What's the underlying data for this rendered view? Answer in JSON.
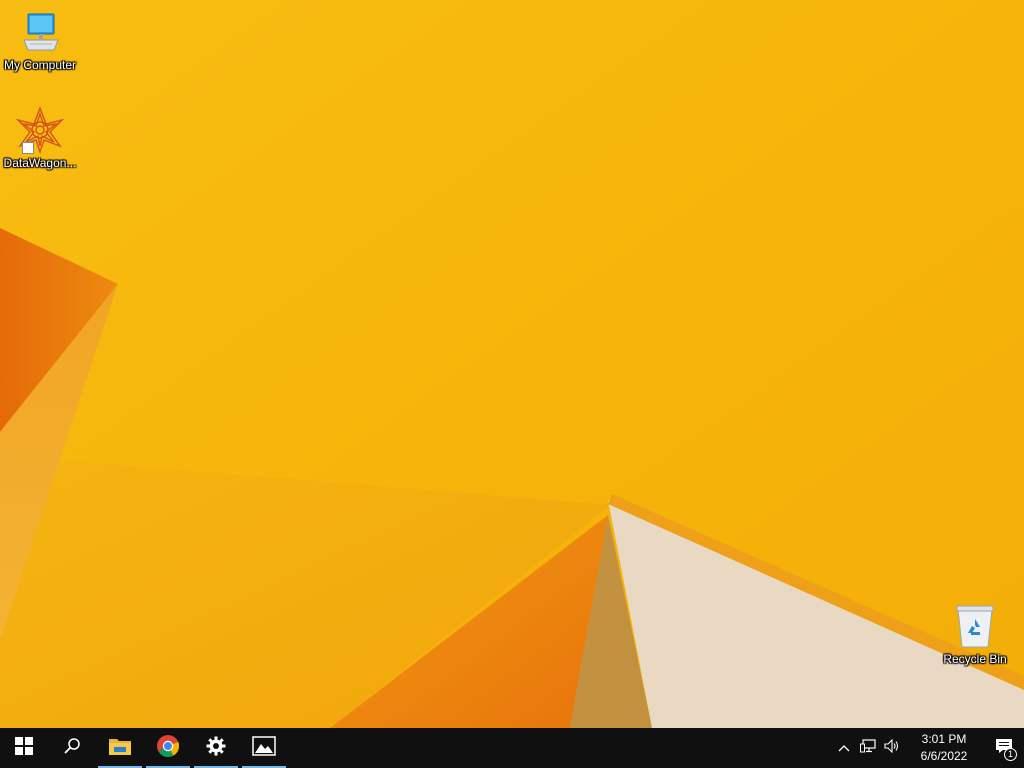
{
  "desktop": {
    "icons": [
      {
        "label": "My Computer",
        "icon": "computer-icon"
      },
      {
        "label": "DataWagon...",
        "icon": "datawagon-icon"
      },
      {
        "label": "Recycle Bin",
        "icon": "recycle-bin-icon"
      }
    ]
  },
  "taskbar": {
    "buttons": [
      {
        "icon": "windows-start-icon",
        "running": false
      },
      {
        "icon": "search-icon",
        "running": false
      },
      {
        "icon": "file-explorer-icon",
        "running": true
      },
      {
        "icon": "chrome-icon",
        "running": true
      },
      {
        "icon": "settings-gear-icon",
        "running": true
      },
      {
        "icon": "photos-icon",
        "running": true
      }
    ],
    "tray": {
      "icons": [
        "chevron-up-icon",
        "network-icon",
        "volume-icon"
      ],
      "time": "3:01 PM",
      "date": "6/6/2022",
      "notification_count": "1"
    }
  },
  "colors": {
    "wallpaper_base": "#f6b40a",
    "wallpaper_orange": "#e8700a",
    "wallpaper_cream": "#ead9c2",
    "taskbar": "#101010",
    "running_indicator": "#76b9ed"
  }
}
